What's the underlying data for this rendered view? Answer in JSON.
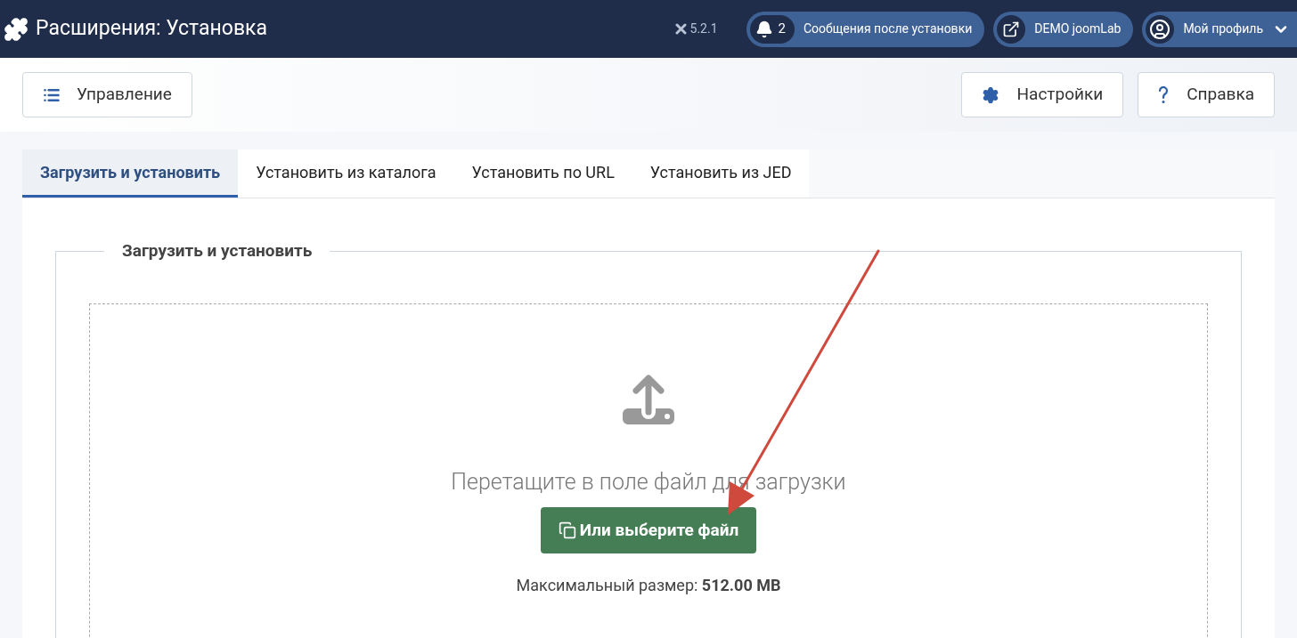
{
  "header": {
    "title": "Расширения: Установка",
    "version": "5.2.1",
    "notifications": {
      "count": "2",
      "label": "Сообщения после установки"
    },
    "site_link": "DEMO joomLab",
    "profile": "Мой профиль"
  },
  "toolbar": {
    "left": [
      "Управление"
    ],
    "right": [
      "Настройки",
      "Справка"
    ]
  },
  "tabs": [
    {
      "label": "Загрузить и установить",
      "selected": true
    },
    {
      "label": "Установить из каталога",
      "selected": false
    },
    {
      "label": "Установить по URL",
      "selected": false
    },
    {
      "label": "Установить из JED",
      "selected": false
    }
  ],
  "upload": {
    "legend": "Загрузить и установить",
    "drop_text": "Перетащите в поле файл для загрузки",
    "button": "Или выберите файл",
    "max_size": "Максимальный размер: **512.00 MB**"
  }
}
